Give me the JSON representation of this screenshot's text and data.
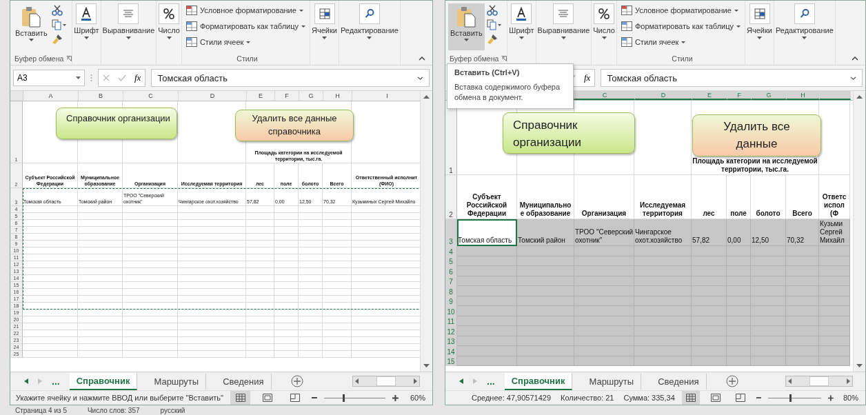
{
  "windows": [
    {
      "ribbon": {
        "paste": {
          "label": "Вставить",
          "hovered": false
        },
        "clipboard_group": "Буфер обмена",
        "groups": [
          "Шрифт",
          "Выравнивание",
          "Число"
        ],
        "style_items": [
          "Условное форматирование",
          "Форматировать как таблицу",
          "Стили ячеек"
        ],
        "styles_group": "Стили",
        "cells": "Ячейки",
        "editing": "Редактирование"
      },
      "name_box": "A3",
      "fx_label": "fx",
      "formula": "Томская область",
      "columns": [
        "A",
        "B",
        "C",
        "D",
        "E",
        "F",
        "G",
        "H",
        "I"
      ],
      "rows": [
        "1",
        "2",
        "3",
        "4",
        "5",
        "6",
        "7",
        "8",
        "9",
        "10",
        "11",
        "12",
        "13",
        "14",
        "15",
        "16",
        "17",
        "18",
        "19",
        "20",
        "21",
        "22",
        "23",
        "24",
        "25"
      ],
      "shapes": [
        {
          "label": "Справочник организации",
          "kind": "green"
        },
        {
          "label": "Удалить все данные\nсправочника",
          "kind": "orange"
        }
      ],
      "area_header": "Площадь категории на исследуемой\nтерритории, тыс.га.",
      "headers": [
        "Субъект Российской\nФедерации",
        "Муниципальное\nобразование",
        "Организация",
        "Исследуемая территория",
        "лес",
        "поле",
        "болото",
        "Всего",
        "Ответственный исполнит\n(ФИО)"
      ],
      "data": [
        "Томская область",
        "Томский район",
        "ТРОО \"Северский\nохотник\"",
        "Чингарское охот.хозяйство",
        "57,82",
        "0,00",
        "12,50",
        "70,32",
        "Кузьминых Сергей Михайло"
      ],
      "copy_marquee": true,
      "selection": false,
      "sheet_nav": "...",
      "sheet_tabs": [
        {
          "label": "Справочник",
          "selected": true
        },
        {
          "label": "Маршруты",
          "selected": false
        },
        {
          "label": "Сведения",
          "selected": false
        }
      ],
      "status": {
        "message": "Укажите ячейку и нажмите ВВОД или выберите \"Вставить\""
      },
      "zoom_slider": {
        "level": 0.3
      },
      "zoom": "60%"
    },
    {
      "ribbon": {
        "paste": {
          "label": "Вставить",
          "hovered": true
        },
        "clipboard_group": "Буфер обмена",
        "groups": [
          "Шрифт",
          "Выравнивание",
          "Число"
        ],
        "style_items": [
          "Условное форматирование",
          "Форматировать как таблицу",
          "Стили ячеек"
        ],
        "styles_group": "Стили",
        "cells": "Ячейки",
        "editing": "Редактирование"
      },
      "tooltip": {
        "title": "Вставить (Ctrl+V)",
        "text": "Вставка содержимого буфера обмена в документ."
      },
      "fx_label": "fx",
      "formula": "Томская область",
      "columns": [
        null,
        null,
        "C",
        "D",
        "E",
        "F",
        "G",
        "H",
        null
      ],
      "rows": [
        "1",
        "2",
        "3",
        "4",
        "5",
        "6",
        "7",
        "8",
        "9",
        "10",
        "11",
        "12",
        "13",
        "14",
        "15"
      ],
      "shapes": [
        {
          "label": "Справочник\nорганизации",
          "kind": "green"
        },
        {
          "label": "Удалить все\nданные",
          "kind": "orange"
        }
      ],
      "area_header": "Площадь категории на исследуемой\nтерритории, тыс.га.",
      "headers": [
        "Субъект\nРоссийской\nФедерации",
        "Муниципально\nе образование",
        "Организация",
        "Исследуемая\nтерритория",
        "лес",
        "поле",
        "болото",
        "Всего",
        "Ответс\nиспол\n(Ф"
      ],
      "data": [
        "Томская область",
        "Томский район",
        "ТРОО \"Северский\nохотник\"",
        "Чингарское\nохот.хозяйство",
        "57,82",
        "0,00",
        "12,50",
        "70,32",
        "Кузьми\nСергей\nМихайл"
      ],
      "copy_marquee": false,
      "selection": true,
      "sheet_nav": "...",
      "sheet_tabs": [
        {
          "label": "Справочник",
          "selected": true
        },
        {
          "label": "Маршруты",
          "selected": false
        },
        {
          "label": "Сведения",
          "selected": false
        }
      ],
      "status": {
        "stats": [
          "Среднее: 47,90571429",
          "Количество: 21",
          "Сумма: 335,34"
        ]
      },
      "zoom_slider": {
        "level": 0.4
      },
      "zoom": "80%"
    }
  ],
  "word_status": [
    "Страница 4 из 5",
    "Число слов: 357",
    "русский"
  ]
}
